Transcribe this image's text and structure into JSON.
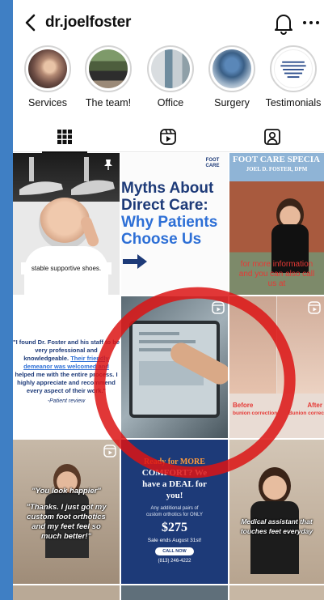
{
  "header": {
    "username": "dr.joelfoster"
  },
  "highlights": [
    {
      "label": "Services"
    },
    {
      "label": "The team!"
    },
    {
      "label": "Office"
    },
    {
      "label": "Surgery"
    },
    {
      "label": "Testimonials"
    }
  ],
  "tabs": [
    "grid",
    "reels",
    "tagged"
  ],
  "posts": {
    "p1": {
      "caption": "stable supportive shoes."
    },
    "p2": {
      "line1": "Myths About",
      "line2": "Direct Care:",
      "line3": "Why Patients",
      "line4": "Choose Us",
      "brand_top": "FOOT",
      "brand_bottom": "CARE"
    },
    "p3": {
      "sign1": "FOOT CARE SPECIA",
      "sign2": "JOEL D. FOSTER, DPM",
      "caption1": "for more information",
      "caption2": "and you can also call",
      "caption3": "us at"
    },
    "p4": {
      "quote1": "\"I found Dr. Foster and his staff to be",
      "quote2": "very professional and",
      "quote3": "knowledgeable.",
      "quote3b": "Their friendly",
      "quote4": "demeanor was welcomed and",
      "quote5": "helped me with the entire process. I",
      "quote6": "highly appreciate and recommend",
      "quote7": "every aspect of their work.\"",
      "source": "-Patient review"
    },
    "p6": {
      "before": "Before",
      "before_sub": "bunion correction",
      "after": "After",
      "after_sub": "Bunion correc"
    },
    "p7": {
      "line1": "\"You look happier\"",
      "line2": "\"Thanks. I just got my",
      "line3": "custom foot orthotics",
      "line4": "and my feet feel so",
      "line5": "much better!\""
    },
    "p8": {
      "head1": "Ready for MORE",
      "head2": "COMFORT? We",
      "head3": "have a DEAL for",
      "head4": "you!",
      "sub1": "Any additional pairs of",
      "sub2": "custom orthotics for ONLY",
      "price": "$275",
      "ends": "Sale ends August 31st!",
      "cta": "CALL NOW",
      "phone": "(813) 246-4222"
    },
    "p9": {
      "line1": "Medical assistant that",
      "line2": "touches feet everyday"
    }
  },
  "colors": {
    "frame": "#3f7fc4",
    "overlay_ring": "#dc1414",
    "navy": "#1d3a78",
    "caption_red": "#e53935"
  }
}
